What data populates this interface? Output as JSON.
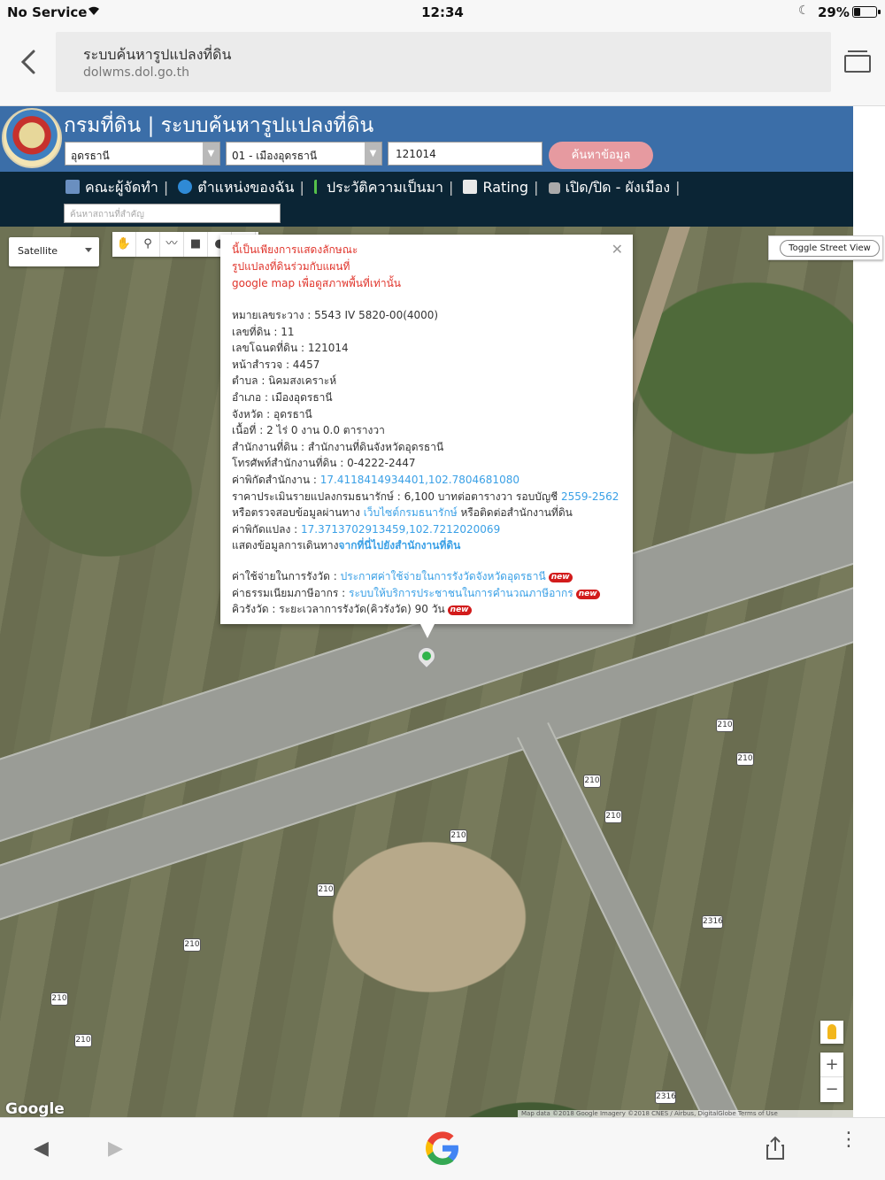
{
  "status_bar": {
    "carrier": "No Service",
    "time": "12:34",
    "battery_percent": "29%",
    "battery_level": 0.29
  },
  "browser": {
    "page_title": "ระบบค้นหารูปแปลงที่ดิน",
    "url": "dolwms.dol.go.th"
  },
  "site": {
    "title": "กรมที่ดิน | ระบบค้นหารูปแปลงที่ดิน",
    "province_selected": "อุดรธานี",
    "district_selected": "01 - เมืองอุดรธานี",
    "deed_number": "121014",
    "search_button": "ค้นหาข้อมูล",
    "place_search_placeholder": "ค้นหาสถานที่สำคัญ"
  },
  "nav": {
    "items": [
      {
        "label": "คณะผู้จัดทำ",
        "icon": "people-icon"
      },
      {
        "label": "ตำแหน่งของฉัน",
        "icon": "globe-icon"
      },
      {
        "label": "ประวัติความเป็นมา",
        "icon": "sprout-icon"
      },
      {
        "label": "Rating",
        "icon": "chart-icon"
      },
      {
        "label": "เปิด/ปิด - ผังเมือง",
        "icon": "toggle-icon"
      }
    ]
  },
  "map": {
    "map_type": "Satellite",
    "toggle_street_view": "Toggle Street View",
    "google_logo": "Google",
    "attribution": "Map data ©2018 Google Imagery ©2018 CNES / Airbus, DigitalGlobe   Terms of Use",
    "road_labels": [
      "210",
      "210",
      "210",
      "210",
      "210",
      "210",
      "210",
      "210",
      "210",
      "2316",
      "2316"
    ],
    "tools": [
      "hand-icon",
      "pin-icon",
      "line-icon",
      "square-icon",
      "circle-icon",
      "flag-icon"
    ],
    "zoom_in": "+",
    "zoom_out": "−"
  },
  "info": {
    "notice_lines": [
      "นี้เป็นเพียงการแสดงลักษณะ",
      "รูปแปลงที่ดินร่วมกับแผนที่",
      "google map เพื่อดูสภาพพื้นที่เท่านั้น"
    ],
    "rows": [
      "หมายเลขระวาง : 5543 IV 5820-00(4000)",
      "เลขที่ดิน : 11",
      "เลขโฉนดที่ดิน : 121014",
      "หน้าสำรวจ : 4457",
      "ตำบล : นิคมสงเคราะห์",
      "อำเภอ : เมืองอุดรธานี",
      "จังหวัด : อุดรธานี",
      "เนื้อที่ : 2 ไร่ 0 งาน 0.0 ตารางวา",
      "สำนักงานที่ดิน : สำนักงานที่ดินจังหวัดอุดรธานี",
      "โทรศัพท์สำนักงานที่ดิน : 0-4222-2447"
    ],
    "office_coord_label": "ค่าพิกัดสำนักงาน : ",
    "office_coord": "17.4118414934401,102.7804681080",
    "price_label": "ราคาประเมินรายแปลงกรมธนารักษ์ : 6,100 บาทต่อตารางวา รอบบัญชี ",
    "price_period": "2559-2562",
    "check_prefix": "หรือตรวจสอบข้อมูลผ่านทาง ",
    "check_link": "เว็บไซต์กรมธนารักษ์",
    "check_suffix": " หรือติดต่อสำนักงานที่ดิน",
    "parcel_coord_label": "ค่าพิกัดแปลง : ",
    "parcel_coord": "17.3713702913459,102.7212020069",
    "route_label": "แสดงข้อมูลการเดินทาง",
    "route_link": "จากที่นี่ไปยังสำนักงานที่ดิน",
    "fee_label": "ค่าใช้จ่ายในการรังวัด : ",
    "fee_link": "ประกาศค่าใช้จ่ายในการรังวัดจังหวัดอุดรธานี",
    "tax_label": "ค่าธรรมเนียมภาษีอากร : ",
    "tax_link": "ระบบให้บริการประชาชนในการคำนวณภาษีอากร",
    "survey_line": "คิวรังวัด : ระยะเวลาการรังวัด(คิวรังวัด) 90 วัน",
    "new_badge": "new"
  }
}
